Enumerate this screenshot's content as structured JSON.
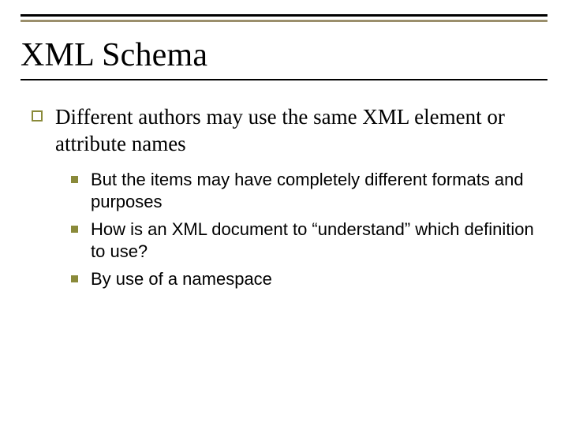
{
  "title": "XML Schema",
  "body": {
    "level1": [
      {
        "text": "Different authors may use the same XML element or attribute names",
        "level2": [
          {
            "text": "But the items may have completely different formats and purposes"
          },
          {
            "text": "How is an XML document to “understand” which definition to use?"
          },
          {
            "text": "By use of a namespace"
          }
        ]
      }
    ]
  }
}
